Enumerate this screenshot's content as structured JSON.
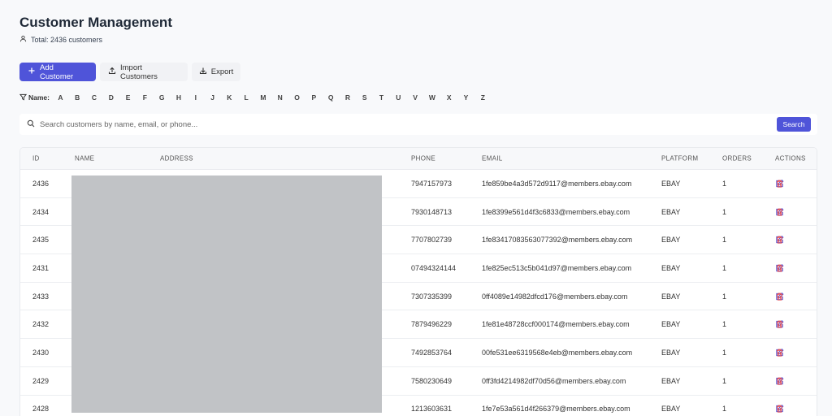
{
  "header": {
    "title": "Customer Management",
    "total_text": "Total: 2436 customers"
  },
  "toolbar": {
    "add_label": "Add Customer",
    "import_label": "Import Customers",
    "export_label": "Export"
  },
  "filter": {
    "label": "Name:",
    "letters": [
      "A",
      "B",
      "C",
      "D",
      "E",
      "F",
      "G",
      "H",
      "I",
      "J",
      "K",
      "L",
      "M",
      "N",
      "O",
      "P",
      "Q",
      "R",
      "S",
      "T",
      "U",
      "V",
      "W",
      "X",
      "Y",
      "Z"
    ]
  },
  "search": {
    "placeholder": "Search customers by name, email, or phone...",
    "button_label": "Search"
  },
  "table": {
    "headers": {
      "id": "ID",
      "name": "NAME",
      "address": "ADDRESS",
      "phone": "PHONE",
      "email": "EMAIL",
      "platform": "PLATFORM",
      "orders": "ORDERS",
      "actions": "ACTIONS"
    },
    "rows": [
      {
        "id": "2436",
        "phone": "7947157973",
        "email": "1fe859be4a3d572d9117@members.ebay.com",
        "platform": "EBAY",
        "orders": "1"
      },
      {
        "id": "2434",
        "phone": "7930148713",
        "email": "1fe8399e561d4f3c6833@members.ebay.com",
        "platform": "EBAY",
        "orders": "1"
      },
      {
        "id": "2435",
        "phone": "7707802739",
        "email": "1fe83417083563077392@members.ebay.com",
        "platform": "EBAY",
        "orders": "1"
      },
      {
        "id": "2431",
        "phone": "07494324144",
        "email": "1fe825ec513c5b041d97@members.ebay.com",
        "platform": "EBAY",
        "orders": "1"
      },
      {
        "id": "2433",
        "phone": "7307335399",
        "email": "0ff4089e14982dfcd176@members.ebay.com",
        "platform": "EBAY",
        "orders": "1"
      },
      {
        "id": "2432",
        "phone": "7879496229",
        "email": "1fe81e48728ccf000174@members.ebay.com",
        "platform": "EBAY",
        "orders": "1"
      },
      {
        "id": "2430",
        "phone": "7492853764",
        "email": "00fe531ee6319568e4eb@members.ebay.com",
        "platform": "EBAY",
        "orders": "1"
      },
      {
        "id": "2429",
        "phone": "7580230649",
        "email": "0ff3fd4214982df70d56@members.ebay.com",
        "platform": "EBAY",
        "orders": "1"
      },
      {
        "id": "2428",
        "phone": "1213603631",
        "email": "1fe7e53a561d4f266379@members.ebay.com",
        "platform": "EBAY",
        "orders": "1"
      }
    ]
  },
  "colors": {
    "accent": "#4f54d9",
    "edit_icon": "#4f54d9",
    "delete_icon": "#e5484d",
    "redaction": "#c1c3c6"
  },
  "icons": {
    "subtitle": "user-icon",
    "add": "plus-icon",
    "import": "upload-icon",
    "export": "download-icon",
    "filter": "filter-icon",
    "search": "search-icon",
    "edit": "edit-icon",
    "delete": "trash-icon"
  }
}
